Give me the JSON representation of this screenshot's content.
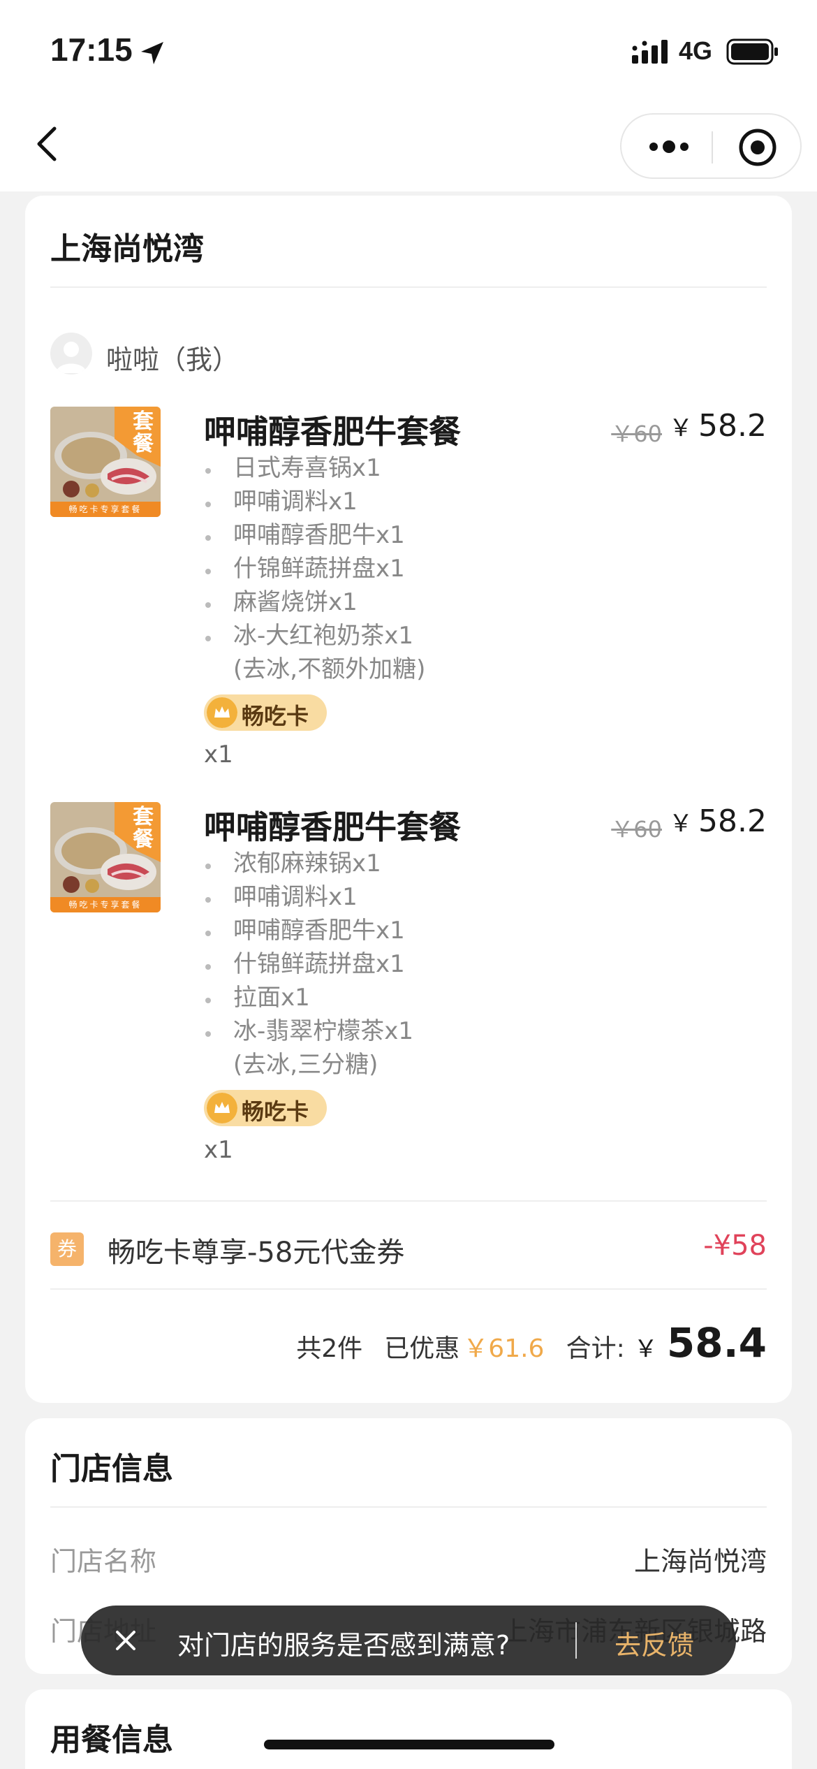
{
  "status_bar": {
    "time": "17:15",
    "network": "4G"
  },
  "order": {
    "store_name": "上海尚悦湾",
    "user_name": "啦啦（我）",
    "items": [
      {
        "name": "呷哺醇香肥牛套餐",
        "original_price": "￥60",
        "price_symbol": "￥",
        "price": "58.2",
        "image_label": "套餐",
        "image_caption": "畅吃卡专享套餐",
        "sub_items": [
          "日式寿喜锅x1",
          "呷哺调料x1",
          "呷哺醇香肥牛x1",
          "什锦鲜蔬拼盘x1",
          "麻酱烧饼x1",
          "冰-大红袍奶茶x1"
        ],
        "note": "(去冰,不额外加糖)",
        "badge": "畅吃卡",
        "quantity": "x1"
      },
      {
        "name": "呷哺醇香肥牛套餐",
        "original_price": "￥60",
        "price_symbol": "￥",
        "price": "58.2",
        "image_label": "套餐",
        "image_caption": "畅吃卡专享套餐",
        "sub_items": [
          "浓郁麻辣锅x1",
          "呷哺调料x1",
          "呷哺醇香肥牛x1",
          "什锦鲜蔬拼盘x1",
          "拉面x1",
          "冰-翡翠柠檬茶x1"
        ],
        "note": "(去冰,三分糖)",
        "badge": "畅吃卡",
        "quantity": "x1"
      }
    ],
    "coupon": {
      "tag": "券",
      "text": "畅吃卡尊享-58元代金券",
      "amount": "-¥58"
    },
    "summary": {
      "count": "共2件",
      "discount_label": "已优惠",
      "discount_value": "￥61.6",
      "total_label": "合计:",
      "total_symbol": "￥",
      "total_value": "58.4"
    }
  },
  "store_info": {
    "title": "门店信息",
    "name_label": "门店名称",
    "name_value": "上海尚悦湾",
    "address_label": "门店地址",
    "address_value": "上海市浦东新区银城路"
  },
  "dining_info": {
    "title": "用餐信息"
  },
  "toast": {
    "text": "对门店的服务是否感到满意?",
    "action": "去反馈"
  },
  "colors": {
    "accent_orange": "#f0a94a",
    "discount_red": "#e0435a",
    "badge_gold": "#f9dca2"
  }
}
